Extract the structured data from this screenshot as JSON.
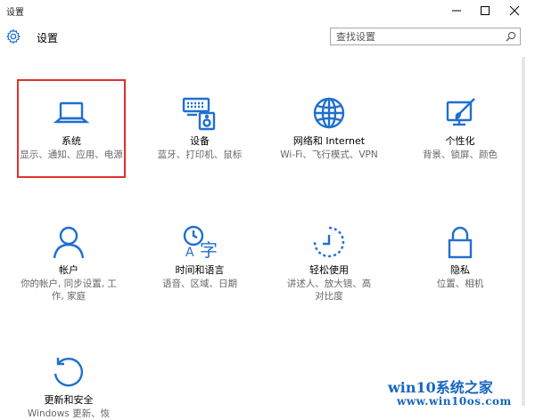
{
  "window": {
    "title": "设置"
  },
  "header": {
    "title": "设置",
    "search_placeholder": "查找设置"
  },
  "colors": {
    "accent": "#1f6fd0",
    "selection_border": "#e0302a",
    "watermark": "#1565c0"
  },
  "tiles": [
    {
      "name": "系统",
      "desc": "显示、通知、应用、电源",
      "icon": "laptop-icon"
    },
    {
      "name": "设备",
      "desc": "蓝牙、打印机、鼠标",
      "icon": "keyboard-speaker-icon"
    },
    {
      "name": "网络和 Internet",
      "desc": "Wi-Fi、飞行模式、VPN",
      "icon": "globe-icon"
    },
    {
      "name": "个性化",
      "desc": "背景、锁屏、颜色",
      "icon": "paint-icon"
    },
    {
      "name": "帐户",
      "desc": "你的帐户, 同步设置, 工作, 家庭",
      "icon": "person-icon"
    },
    {
      "name": "时间和语言",
      "desc": "语音、区域、日期",
      "icon": "time-language-icon"
    },
    {
      "name": "轻松使用",
      "desc": "讲述人、放大镜、高对比度",
      "icon": "ease-of-access-icon"
    },
    {
      "name": "隐私",
      "desc": "位置、相机",
      "icon": "lock-icon"
    },
    {
      "name": "更新和安全",
      "desc": "Windows 更新、恢",
      "icon": "refresh-icon"
    }
  ],
  "watermark": {
    "line1": "win10系统之家",
    "line2": "www.win10os.com"
  }
}
